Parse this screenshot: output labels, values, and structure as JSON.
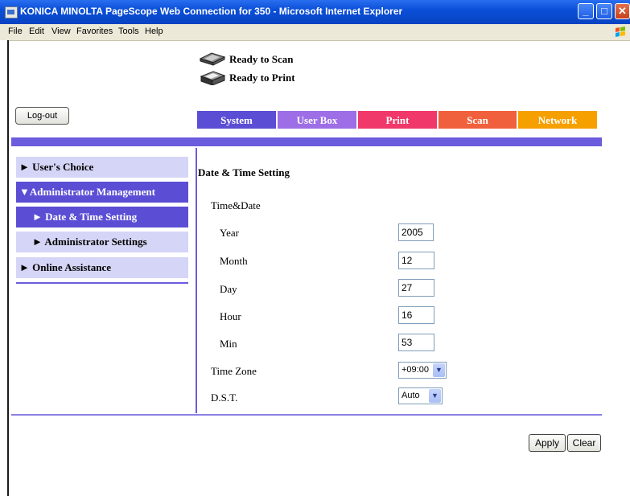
{
  "window": {
    "title": "KONICA MINOLTA PageScope Web Connection for 350 - Microsoft Internet Explorer"
  },
  "menu": [
    "File",
    "Edit",
    "View",
    "Favorites",
    "Tools",
    "Help"
  ],
  "status": {
    "scan": "Ready to Scan",
    "print": "Ready to Print"
  },
  "logout_label": "Log-out",
  "tabs": [
    {
      "label": "System",
      "color": "#5b4ed4"
    },
    {
      "label": "User Box",
      "color": "#9d6ee6"
    },
    {
      "label": "Print",
      "color": "#f0386a"
    },
    {
      "label": "Scan",
      "color": "#f0603c"
    },
    {
      "label": "Network",
      "color": "#f6a000"
    }
  ],
  "nav": [
    {
      "label": "► User's Choice"
    },
    {
      "label": "▼Administrator Management"
    },
    {
      "label": "► Date & Time Setting"
    },
    {
      "label": "► Administrator Settings"
    },
    {
      "label": "► Online Assistance"
    }
  ],
  "form": {
    "heading": "Date & Time Setting",
    "group": "Time&Date",
    "year": {
      "label": "Year",
      "value": "2005"
    },
    "month": {
      "label": "Month",
      "value": "12"
    },
    "day": {
      "label": "Day",
      "value": "27"
    },
    "hour": {
      "label": "Hour",
      "value": "16"
    },
    "min": {
      "label": "Min",
      "value": "53"
    },
    "timezone": {
      "label": "Time Zone",
      "value": "+09:00"
    },
    "dst": {
      "label": "D.S.T.",
      "value": "Auto"
    }
  },
  "buttons": {
    "apply": "Apply",
    "clear": "Clear"
  },
  "colors": {
    "accent": "#6b5cdd",
    "nav_bg": "#d5d5f7",
    "nav_selected": "#5b4ed4"
  }
}
